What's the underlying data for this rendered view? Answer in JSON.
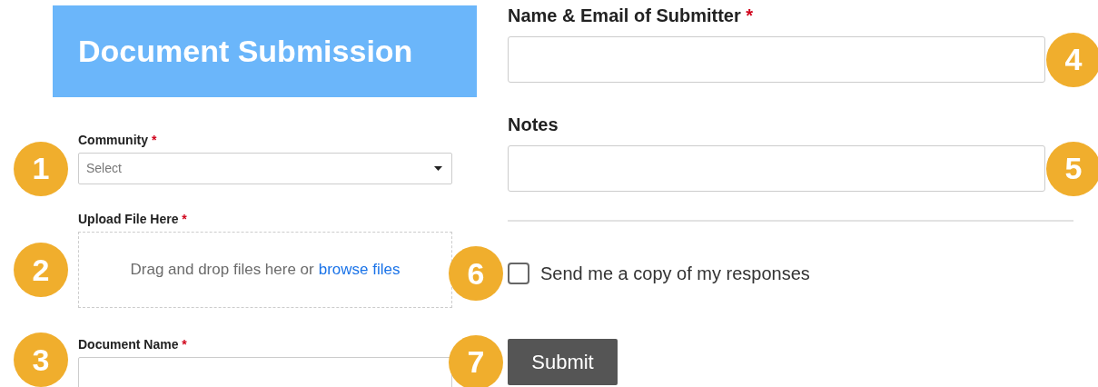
{
  "header": {
    "title": "Document Submission"
  },
  "left_fields": [
    {
      "kind": "select",
      "label": "Community",
      "required_mark": "*",
      "placeholder": "Select",
      "marker": "1"
    },
    {
      "kind": "upload",
      "label": "Upload File Here",
      "required_mark": "*",
      "hint": "Drag and drop files here or",
      "link": "browse files",
      "marker": "2"
    },
    {
      "kind": "text",
      "label": "Document Name",
      "required_mark": "*",
      "marker": "3"
    }
  ],
  "right_fields": [
    {
      "kind": "text",
      "label": "Name & Email of Submitter",
      "required_mark": "*",
      "marker": "4"
    },
    {
      "kind": "text",
      "label": "Notes",
      "marker": "5"
    }
  ],
  "copy_checkbox": {
    "label": "Send me a copy of my responses",
    "checked": false,
    "marker": "6"
  },
  "submit": {
    "label": "Submit",
    "marker": "7"
  }
}
